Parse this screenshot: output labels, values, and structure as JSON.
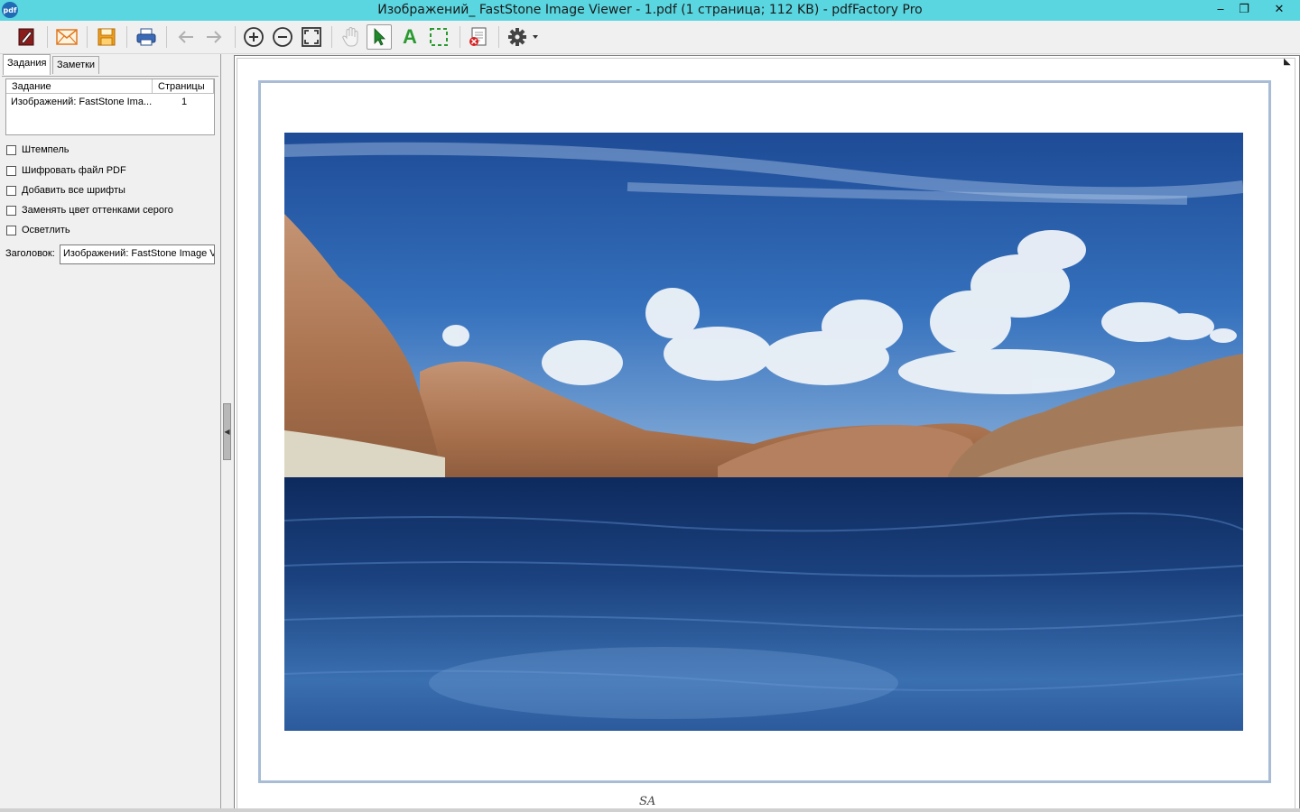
{
  "window": {
    "app_icon_text": "pdf",
    "title": "Изображений_ FastStone Image Viewer - 1.pdf (1 страница; 112 KB) - pdfFactory Pro",
    "minimize": "‒",
    "restore": "❐",
    "close": "✕"
  },
  "toolbar": {
    "buttons": [
      {
        "name": "edit-icon"
      },
      {
        "name": "email-icon"
      },
      {
        "name": "save-icon"
      },
      {
        "name": "print-icon"
      },
      {
        "name": "back-arrow-icon"
      },
      {
        "name": "forward-arrow-icon"
      },
      {
        "name": "zoom-in-icon"
      },
      {
        "name": "zoom-out-icon"
      },
      {
        "name": "fit-page-icon"
      },
      {
        "name": "hand-tool-icon"
      },
      {
        "name": "select-arrow-icon",
        "active": true
      },
      {
        "name": "text-select-icon"
      },
      {
        "name": "area-select-icon"
      },
      {
        "name": "delete-page-icon"
      },
      {
        "name": "settings-gear-icon"
      }
    ],
    "text_tool_glyph": "A"
  },
  "left_panel": {
    "tabs": [
      {
        "label": "Задания",
        "selected": true
      },
      {
        "label": "Заметки",
        "selected": false
      }
    ],
    "job_list": {
      "columns": [
        "Задание",
        "Страницы"
      ],
      "rows": [
        {
          "job": "Изображений: FastStone Ima...",
          "pages": "1"
        }
      ]
    },
    "options": [
      {
        "label": "Штемпель",
        "checked": false
      },
      {
        "label": "Шифровать файл PDF",
        "checked": false
      },
      {
        "label": "Добавить все шрифты",
        "checked": false
      },
      {
        "label": "Заменять цвет оттенками серого",
        "checked": false
      },
      {
        "label": "Осветлить",
        "checked": false
      }
    ],
    "title_field": {
      "label": "Заголовок:",
      "value": "Изображений: FastStone Image V"
    }
  },
  "preview": {
    "signature": "SA",
    "image_subject": "lake-landscape-photo"
  },
  "colors": {
    "titlebar": "#5ad6e0",
    "page_border": "#a8bcd6",
    "sky": "#2f5ea8",
    "water": "#1b3f7e"
  }
}
